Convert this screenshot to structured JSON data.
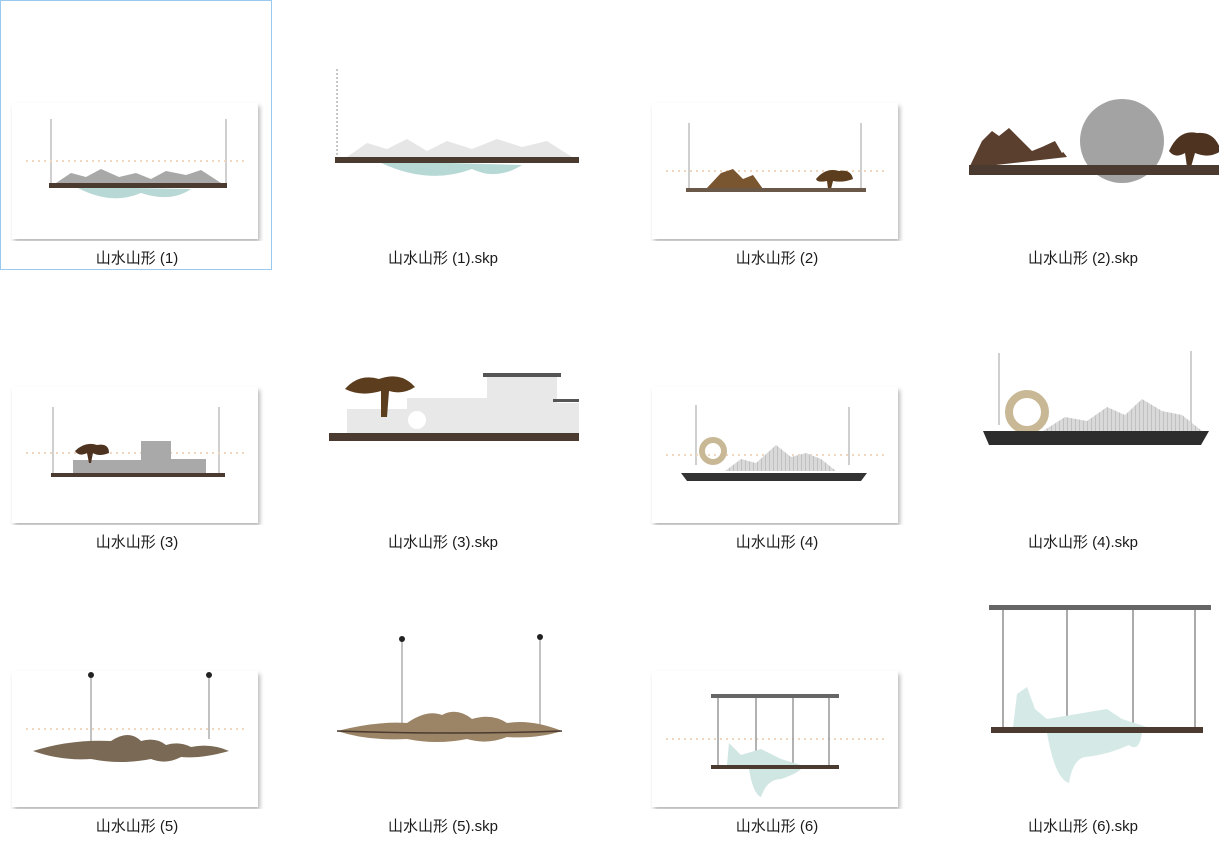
{
  "files": [
    {
      "name": "山水山形 (1)",
      "type": "image",
      "selected": true
    },
    {
      "name": "山水山形 (1).skp",
      "type": "skp"
    },
    {
      "name": "山水山形 (2)",
      "type": "image"
    },
    {
      "name": "山水山形 (2).skp",
      "type": "skp"
    },
    {
      "name": "山水山形 (3)",
      "type": "image"
    },
    {
      "name": "山水山形 (3).skp",
      "type": "skp"
    },
    {
      "name": "山水山形 (4)",
      "type": "image"
    },
    {
      "name": "山水山形 (4).skp",
      "type": "skp"
    },
    {
      "name": "山水山形 (5)",
      "type": "image"
    },
    {
      "name": "山水山形 (5).skp",
      "type": "skp"
    },
    {
      "name": "山水山形 (6)",
      "type": "image"
    },
    {
      "name": "山水山形 (6).skp",
      "type": "skp"
    }
  ],
  "colors": {
    "selection_border": "#99c9ef",
    "text": "#1a1a1a"
  }
}
